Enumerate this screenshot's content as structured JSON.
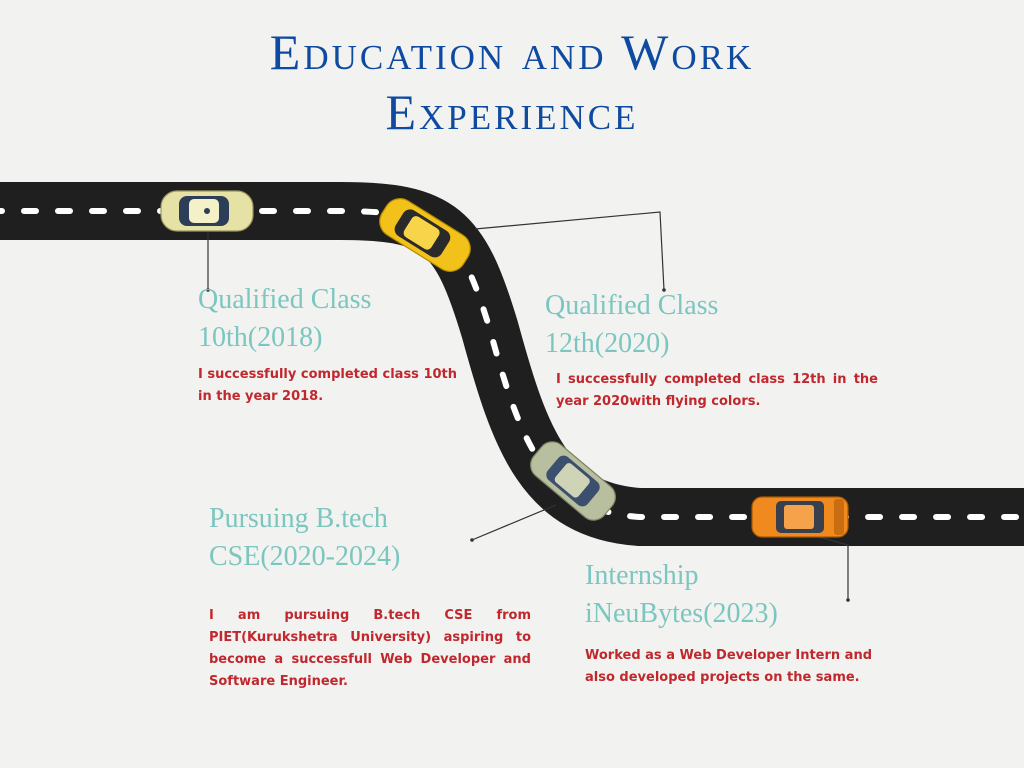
{
  "title": {
    "line1": "Education and Work",
    "line2": "Experience"
  },
  "colors": {
    "title": "#0d4aa0",
    "heading": "#7cc6c0",
    "description": "#c0282d",
    "road": "#1f1f1f",
    "road_marking": "#ffffff"
  },
  "milestones": [
    {
      "heading_line1": "Qualified Class",
      "heading_line2": "10th(2018)",
      "description": "I successfully completed class 10th in the year 2018.",
      "car_color": "light-green"
    },
    {
      "heading_line1": "Qualified Class",
      "heading_line2": "12th(2020)",
      "description": "I successfully completed class 12th in the year 2020with flying colors.",
      "car_color": "yellow"
    },
    {
      "heading_line1": "Pursuing B.tech",
      "heading_line2": "CSE(2020-2024)",
      "description": "I am pursuing B.tech CSE from PIET(Kurukshetra University) aspiring to become a successfull Web Developer and Software Engineer.",
      "car_color": "grey-green"
    },
    {
      "heading_line1": "Internship",
      "heading_line2": "iNeuBytes(2023)",
      "description": "Worked as a Web Developer Intern and also developed projects on the same.",
      "car_color": "orange"
    }
  ]
}
